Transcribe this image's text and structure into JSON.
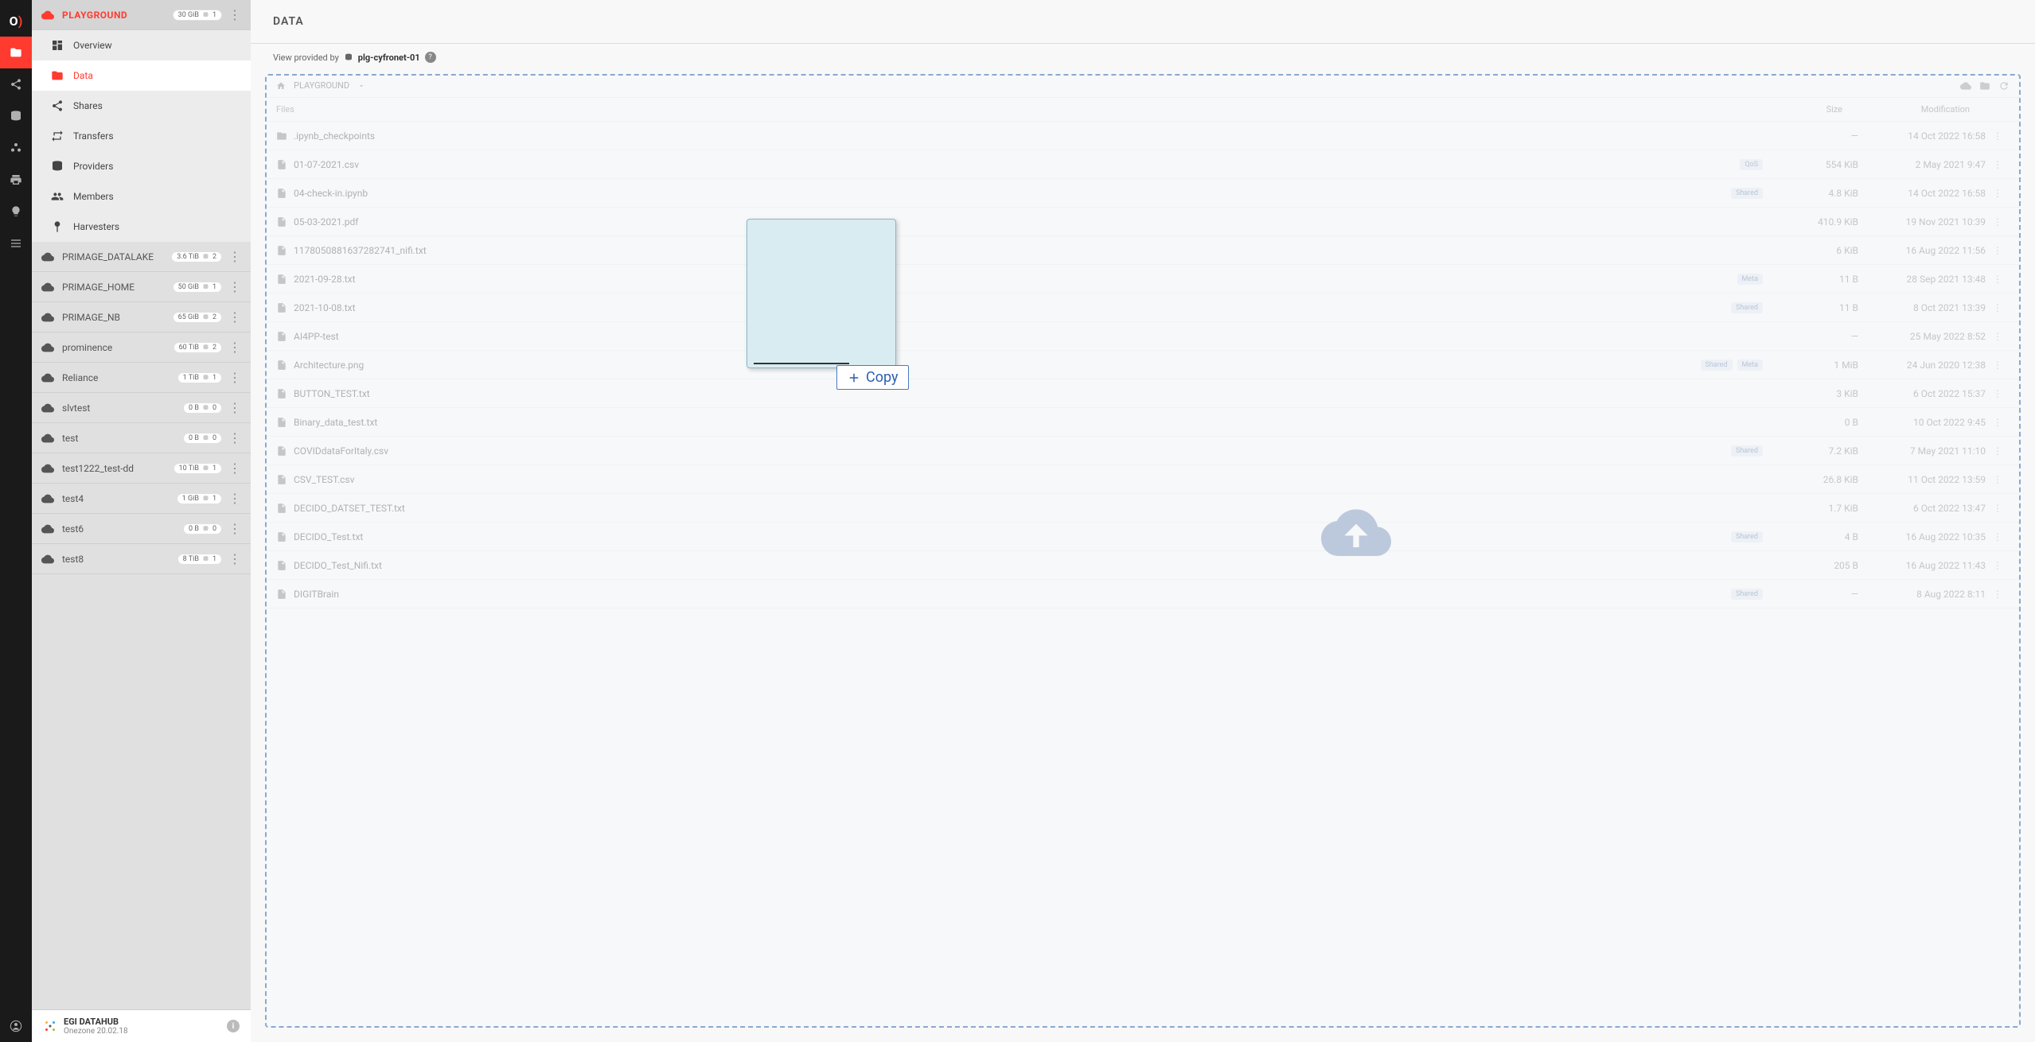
{
  "rail": {
    "active_index": 1
  },
  "sidebar": {
    "spaces": [
      {
        "name": "PLAYGROUND",
        "size": "30 GiB",
        "count": "1",
        "selected": true
      },
      {
        "name": "PRIMAGE_DATALAKE",
        "size": "3.6 TiB",
        "count": "2"
      },
      {
        "name": "PRIMAGE_HOME",
        "size": "50 GiB",
        "count": "1"
      },
      {
        "name": "PRIMAGE_NB",
        "size": "65 GiB",
        "count": "2"
      },
      {
        "name": "prominence",
        "size": "60 TiB",
        "count": "2"
      },
      {
        "name": "Reliance",
        "size": "1 TiB",
        "count": "1"
      },
      {
        "name": "slvtest",
        "size": "0 B",
        "count": "0"
      },
      {
        "name": "test",
        "size": "0 B",
        "count": "0"
      },
      {
        "name": "test1222_test-dd",
        "size": "10 TiB",
        "count": "1"
      },
      {
        "name": "test4",
        "size": "1 GiB",
        "count": "1"
      },
      {
        "name": "test6",
        "size": "0 B",
        "count": "0"
      },
      {
        "name": "test8",
        "size": "8 TiB",
        "count": "1"
      }
    ],
    "subnav": [
      {
        "label": "Overview"
      },
      {
        "label": "Data",
        "active": true
      },
      {
        "label": "Shares"
      },
      {
        "label": "Transfers"
      },
      {
        "label": "Providers"
      },
      {
        "label": "Members"
      },
      {
        "label": "Harvesters"
      }
    ],
    "footer": {
      "title": "EGI DATAHUB",
      "sub": "Onezone 20.02.18"
    }
  },
  "main": {
    "title": "DATA",
    "view_label": "View provided by",
    "provider": "plg-cyfronet-01",
    "breadcrumb": "PLAYGROUND",
    "columns": {
      "files": "Files",
      "size": "Size",
      "mod": "Modification"
    },
    "copy_label": "Copy",
    "files": [
      {
        "icon": "folder",
        "name": ".ipynb_checkpoints",
        "tags": [],
        "size": "—",
        "mod": "14 Oct 2022 16:58"
      },
      {
        "icon": "file",
        "name": "01-07-2021.csv",
        "tags": [
          "QoS"
        ],
        "size": "554 KiB",
        "mod": "2 May 2021 9:47"
      },
      {
        "icon": "file",
        "name": "04-check-in.ipynb",
        "tags": [
          "Shared"
        ],
        "size": "4.8 KiB",
        "mod": "14 Oct 2022 16:58"
      },
      {
        "icon": "file",
        "name": "05-03-2021.pdf",
        "tags": [],
        "size": "410.9 KiB",
        "mod": "19 Nov 2021 10:39"
      },
      {
        "icon": "file",
        "name": "1178050881637282741_nifi.txt",
        "tags": [],
        "size": "6 KiB",
        "mod": "16 Aug 2022 11:56"
      },
      {
        "icon": "file",
        "name": "2021-09-28.txt",
        "tags": [
          "Meta"
        ],
        "size": "11 B",
        "mod": "28 Sep 2021 13:48"
      },
      {
        "icon": "file",
        "name": "2021-10-08.txt",
        "tags": [
          "Shared"
        ],
        "size": "11 B",
        "mod": "8 Oct 2021 13:39"
      },
      {
        "icon": "file",
        "name": "AI4PP-test",
        "tags": [],
        "size": "—",
        "mod": "25 May 2022 8:52"
      },
      {
        "icon": "file",
        "name": "Architecture.png",
        "tags": [
          "Shared",
          "Meta"
        ],
        "size": "1 MiB",
        "mod": "24 Jun 2020 12:38"
      },
      {
        "icon": "file",
        "name": "BUTTON_TEST.txt",
        "tags": [],
        "size": "3 KiB",
        "mod": "6 Oct 2022 15:37"
      },
      {
        "icon": "file",
        "name": "Binary_data_test.txt",
        "tags": [],
        "size": "0 B",
        "mod": "10 Oct 2022 9:45"
      },
      {
        "icon": "file",
        "name": "COVIDdataForItaly.csv",
        "tags": [
          "Shared"
        ],
        "size": "7.2 KiB",
        "mod": "7 May 2021 11:10"
      },
      {
        "icon": "file",
        "name": "CSV_TEST.csv",
        "tags": [],
        "size": "26.8 KiB",
        "mod": "11 Oct 2022 13:59"
      },
      {
        "icon": "file",
        "name": "DECIDO_DATSET_TEST.txt",
        "tags": [],
        "size": "1.7 KiB",
        "mod": "6 Oct 2022 13:47"
      },
      {
        "icon": "file",
        "name": "DECIDO_Test.txt",
        "tags": [
          "Shared"
        ],
        "size": "4 B",
        "mod": "16 Aug 2022 10:35"
      },
      {
        "icon": "file",
        "name": "DECIDO_Test_Nifi.txt",
        "tags": [],
        "size": "205 B",
        "mod": "16 Aug 2022 11:43"
      },
      {
        "icon": "file",
        "name": "DIGITBrain",
        "tags": [
          "Shared"
        ],
        "size": "—",
        "mod": "8 Aug 2022 8:11"
      }
    ]
  }
}
